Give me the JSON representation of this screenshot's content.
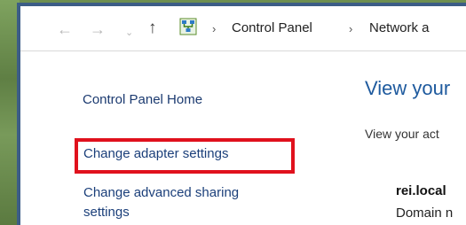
{
  "navigation": {
    "back_icon": "←",
    "forward_icon": "→",
    "recent_icon": "⌄",
    "up_icon": "↑",
    "separator": "›",
    "breadcrumbs": [
      "Control Panel",
      "Network a"
    ]
  },
  "sidebar": {
    "home_label": "Control Panel Home",
    "links": [
      "Change adapter settings",
      "Change advanced sharing",
      "settings"
    ]
  },
  "main": {
    "title": "View your",
    "subtitle": "View your act",
    "network_name": "rei.local",
    "network_type": "Domain n"
  },
  "colors": {
    "link": "#1b3f7a",
    "title": "#1e5a9e",
    "highlight": "#e0111d",
    "window_border": "#3c5d86"
  }
}
